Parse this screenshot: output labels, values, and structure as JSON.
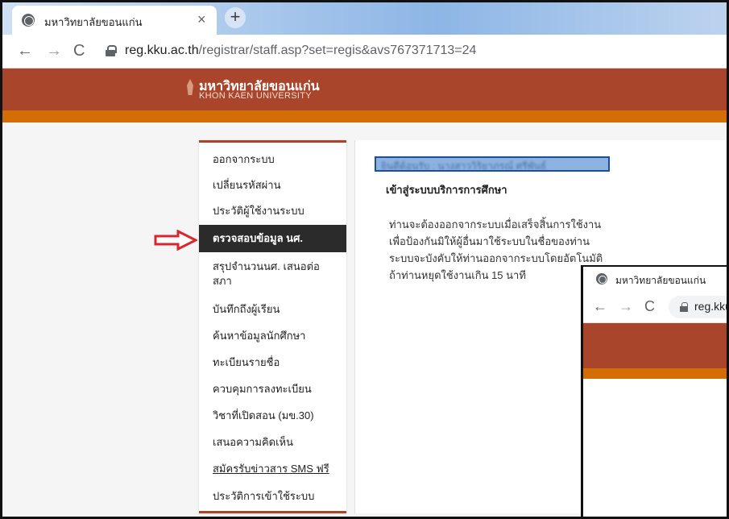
{
  "browser": {
    "tab_title": "มหาวิทยาลัยขอนแก่น",
    "tab_close": "×",
    "new_tab": "+",
    "url_host": "reg.kku.ac.th",
    "url_path": "/registrar/staff.asp?set=regis&avs767371713=24"
  },
  "header": {
    "name_th": "มหาวิทยาลัยขอนแก่น",
    "name_en": "KHON KAEN UNIVERSITY"
  },
  "menu": {
    "items": [
      {
        "label": "ออกจากระบบ"
      },
      {
        "label": "เปลี่ยนรหัสผ่าน"
      },
      {
        "label": "ประวัติผู้ใช้งานระบบ"
      },
      {
        "label": "ตรวจสอบข้อมูล นศ."
      },
      {
        "label": "สรุปจำนวนนศ. เสนอต่อสภา"
      },
      {
        "label": "บันทึกถึงผู้เรียน"
      },
      {
        "label": "ค้นหาข้อมูลนักศึกษา"
      },
      {
        "label": "ทะเบียนรายชื่อ"
      },
      {
        "label": "ควบคุมการลงทะเบียน"
      },
      {
        "label": "วิชาที่เปิดสอน (มข.30)"
      },
      {
        "label": "เสนอความคิดเห็น"
      },
      {
        "label": "สมัครรับข่าวสาร SMS ฟรี"
      },
      {
        "label": "ประวัติการเข้าใช้ระบบ"
      }
    ],
    "active_index": 3
  },
  "main": {
    "welcome": "ยินดีต้อนรับ : นางสาววิริยาภรณ์ ศรีพันธ์",
    "title": "เข้าสู่ระบบบริการการศึกษา",
    "para": "ท่านจะต้องออกจากระบบเมื่อเสร็จสิ้นการใช้งาน เพื่อป้องกันมิให้ผู้อื่นมาใช้ระบบในชื่อของท่าน ระบบจะบังคับให้ท่านออกจากระบบโดยอัตโนมัติ ถ้าท่านหยุดใช้งานเกิน 15 นาที"
  },
  "overlay": {
    "tab_title": "มหาวิทยาลัยขอนแก่น",
    "url": "reg.kku"
  },
  "colors": {
    "header": "#a9452a",
    "band": "#d36d05",
    "arrow": "#d9262c",
    "active_bg": "#2b2b2b"
  }
}
